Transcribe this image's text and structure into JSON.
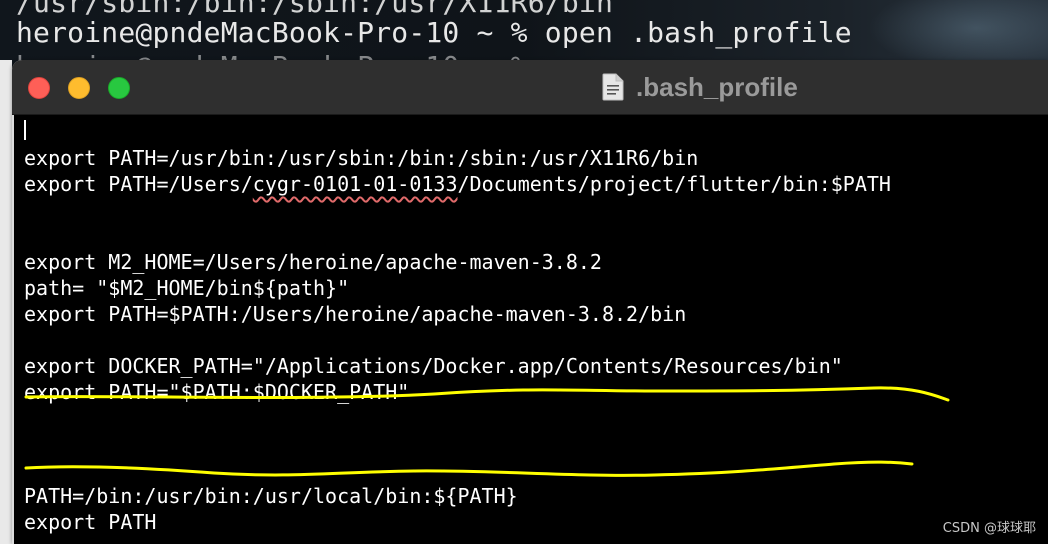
{
  "background_terminal": {
    "partial_line": "/usr/sbin:/bin:/sbin:/usr/X11R6/bin",
    "command_line": "heroine@pndeMacBook-Pro-10 ~ % open .bash_profile",
    "faded_line": "heroine@pndeMacBook-Pro-10 ~ %"
  },
  "window": {
    "title": ".bash_profile",
    "title_icon": "document-icon"
  },
  "editor": {
    "lines": [
      {
        "row": 1,
        "text": "export PATH=/usr/bin:/usr/sbin:/bin:/sbin:/usr/X11R6/bin"
      },
      {
        "row": 2,
        "prefix": "export PATH=/Users/",
        "misspelled": "cygr-0101-01-0133",
        "suffix": "/Documents/project/flutter/bin:$PATH"
      },
      {
        "row": 5,
        "text": "export M2_HOME=/Users/heroine/apache-maven-3.8.2"
      },
      {
        "row": 6,
        "text": "path= \"$M2_HOME/bin${path}\""
      },
      {
        "row": 7,
        "text": "export PATH=$PATH:/Users/heroine/apache-maven-3.8.2/bin"
      },
      {
        "row": 9,
        "text": "export DOCKER_PATH=\"/Applications/Docker.app/Contents/Resources/bin\""
      },
      {
        "row": 10,
        "text": "export PATH=\"$PATH:$DOCKER_PATH\""
      },
      {
        "row": 14,
        "text": "PATH=/bin:/usr/bin:/usr/local/bin:${PATH}"
      },
      {
        "row": 15,
        "text": "export PATH"
      }
    ]
  },
  "annotation_color": "#ffff00",
  "watermark": "CSDN @球球耶"
}
